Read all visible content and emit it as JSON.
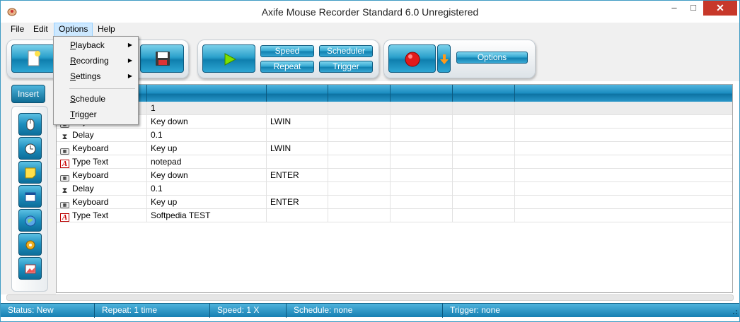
{
  "window": {
    "title": "Axife Mouse Recorder Standard 6.0 Unregistered",
    "controls": {
      "minimize": "–",
      "maximize": "□",
      "close": "✕"
    }
  },
  "menubar": {
    "items": [
      "File",
      "Edit",
      "Options",
      "Help"
    ],
    "active": "Options"
  },
  "options_menu": {
    "items": [
      {
        "label": "Playback",
        "mnemonic": "P",
        "rest": "layback",
        "submenu": true
      },
      {
        "label": "Recording",
        "mnemonic": "R",
        "rest": "ecording",
        "submenu": true
      },
      {
        "label": "Settings",
        "mnemonic": "S",
        "rest": "ettings",
        "submenu": true
      },
      {
        "label": "Schedule",
        "mnemonic": "S",
        "rest": "chedule",
        "submenu": false
      },
      {
        "label": "Trigger",
        "mnemonic": "T",
        "rest": "rigger",
        "submenu": false
      }
    ]
  },
  "toolbar": {
    "speed": "Speed",
    "scheduler": "Scheduler",
    "repeat": "Repeat",
    "trigger": "Trigger",
    "options": "Options"
  },
  "sidebar": {
    "insert_label": "Insert",
    "buttons": [
      "mouse-icon",
      "clock-icon",
      "note-icon",
      "window-icon",
      "globe-icon",
      "gear-icon",
      "image-icon"
    ]
  },
  "grid": {
    "rows": [
      {
        "icon": "mouse-icon",
        "type": "",
        "c1": "1",
        "c2": "",
        "selected": true
      },
      {
        "icon": "keyboard-icon",
        "type": "Keyboard",
        "c1": "Key down",
        "c2": "LWIN"
      },
      {
        "icon": "delay-icon",
        "type": "Delay",
        "c1": "0.1",
        "c2": ""
      },
      {
        "icon": "keyboard-icon",
        "type": "Keyboard",
        "c1": "Key up",
        "c2": "LWIN"
      },
      {
        "icon": "text-icon",
        "type": "Type Text",
        "c1": "notepad",
        "c2": ""
      },
      {
        "icon": "keyboard-icon",
        "type": "Keyboard",
        "c1": "Key down",
        "c2": "ENTER"
      },
      {
        "icon": "delay-icon",
        "type": "Delay",
        "c1": "0.1",
        "c2": ""
      },
      {
        "icon": "keyboard-icon",
        "type": "Keyboard",
        "c1": "Key up",
        "c2": "ENTER"
      },
      {
        "icon": "text-icon",
        "type": "Type Text",
        "c1": "Softpedia TEST",
        "c2": ""
      }
    ]
  },
  "statusbar": {
    "status": "Status: New",
    "repeat": "Repeat: 1 time",
    "speed": "Speed: 1 X",
    "schedule": "Schedule: none",
    "trigger": "Trigger: none"
  },
  "colors": {
    "accent": "#1a8cc0",
    "record": "#e21a1a",
    "play": "#7ee000"
  }
}
